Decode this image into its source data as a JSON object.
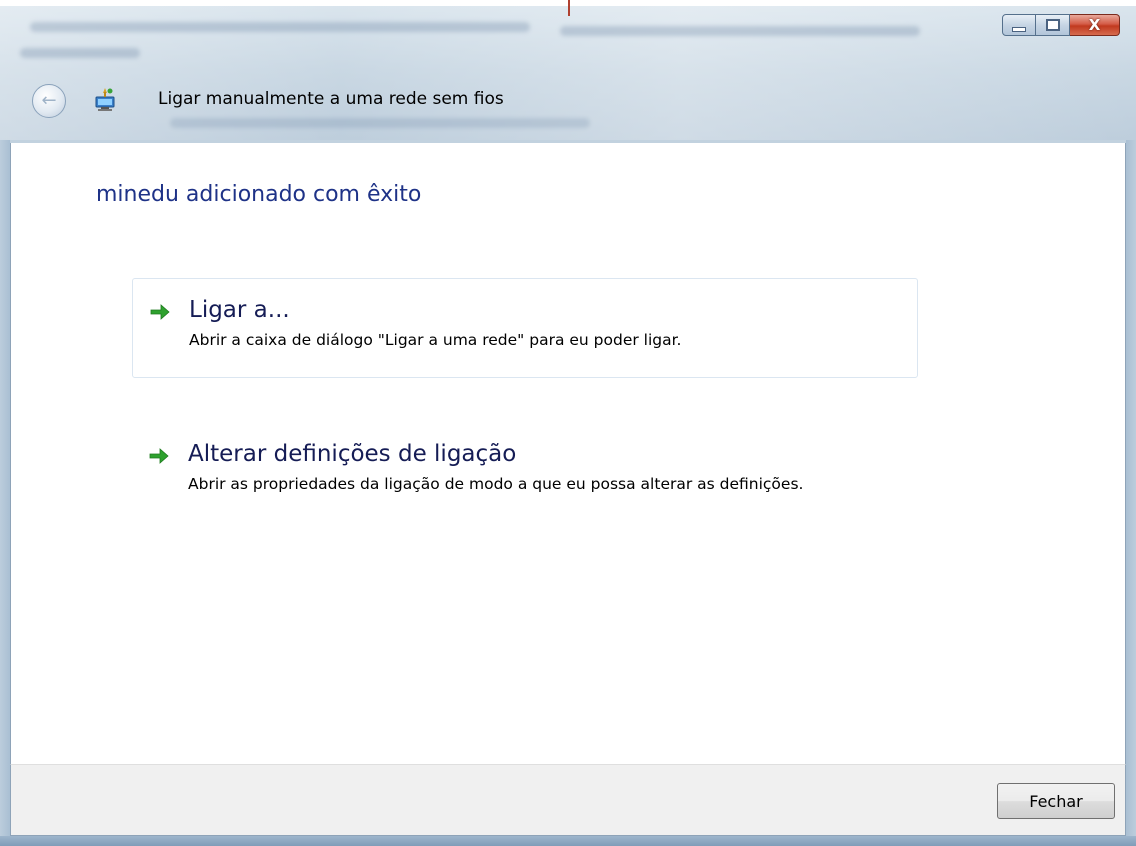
{
  "window": {
    "title": "Ligar manualmente a uma rede sem fios",
    "controls": {
      "minimize_icon": "minimize-icon",
      "maximize_icon": "maximize-icon",
      "close_glyph": "X"
    },
    "back_icon": "back-arrow-icon",
    "app_icon": "wireless-network-icon"
  },
  "content": {
    "heading": "minedu adicionado com êxito",
    "options": [
      {
        "title": "Ligar a...",
        "description": "Abrir a caixa de diálogo \"Ligar a uma rede\" para eu poder ligar.",
        "icon": "green-arrow-icon"
      },
      {
        "title": "Alterar definições de ligação",
        "description": "Abrir as propriedades da ligação de modo a que eu possa alterar as definições.",
        "icon": "green-arrow-icon"
      }
    ]
  },
  "footer": {
    "close_label": "Fechar"
  },
  "colors": {
    "heading": "#1e3287",
    "option_title": "#151c55",
    "arrow_green": "#2ea12e",
    "close_button_red": "#c1391f"
  }
}
